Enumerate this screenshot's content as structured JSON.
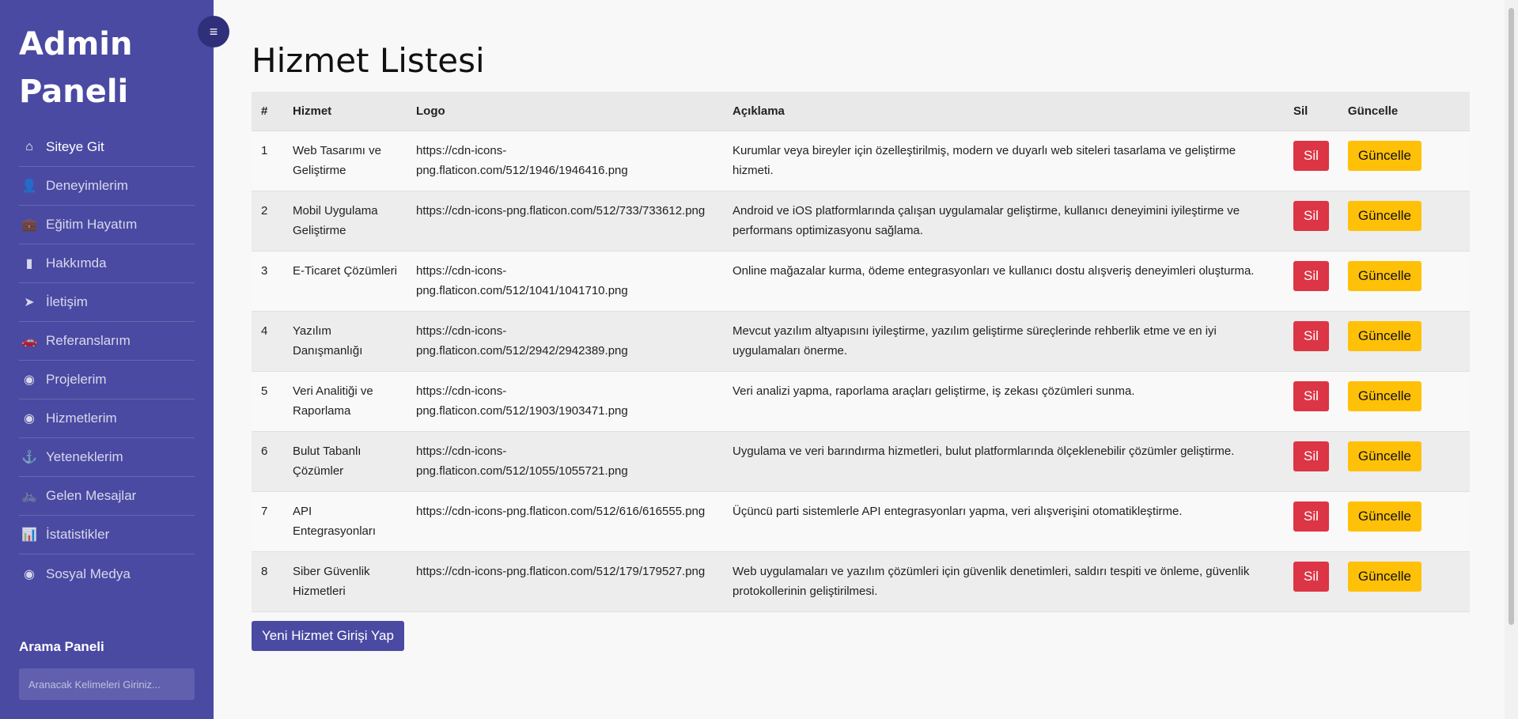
{
  "sidebar": {
    "brand": "Admin Paneli",
    "menu": [
      {
        "label": "Siteye Git",
        "icon": "home-icon",
        "glyph": "⌂",
        "active": true
      },
      {
        "label": "Deneyimlerim",
        "icon": "user-icon",
        "glyph": "👤",
        "active": false
      },
      {
        "label": "Eğitim Hayatım",
        "icon": "briefcase-icon",
        "glyph": "💼",
        "active": false
      },
      {
        "label": "Hakkımda",
        "icon": "sticky-note-icon",
        "glyph": "▮",
        "active": false
      },
      {
        "label": "İletişim",
        "icon": "paper-plane-icon",
        "glyph": "➤",
        "active": false
      },
      {
        "label": "Referanslarım",
        "icon": "car-icon",
        "glyph": "🚗",
        "active": false
      },
      {
        "label": "Projelerim",
        "icon": "user-circle-icon",
        "glyph": "◉",
        "active": false
      },
      {
        "label": "Hizmetlerim",
        "icon": "user-circle-icon",
        "glyph": "◉",
        "active": false
      },
      {
        "label": "Yeteneklerim",
        "icon": "anchor-icon",
        "glyph": "⚓",
        "active": false
      },
      {
        "label": "Gelen Mesajlar",
        "icon": "bicycle-icon",
        "glyph": "🚲",
        "active": false
      },
      {
        "label": "İstatistikler",
        "icon": "bar-chart-icon",
        "glyph": "📊",
        "active": false
      },
      {
        "label": "Sosyal Medya",
        "icon": "user-circle-icon",
        "glyph": "◉",
        "active": false
      }
    ],
    "search_title": "Arama Paneli",
    "search_placeholder": "Aranacak Kelimeleri Giriniz..."
  },
  "toggle": {
    "icon": "hamburger-menu-icon",
    "glyph": "≡"
  },
  "page_title": "Hizmet Listesi",
  "table": {
    "headers": [
      "#",
      "Hizmet",
      "Logo",
      "Açıklama",
      "Sil",
      "Güncelle"
    ],
    "rows": [
      {
        "num": "1",
        "service": "Web Tasarımı ve Geliştirme",
        "logo": "https://cdn-icons-png.flaticon.com/512/1946/1946416.png",
        "desc": "Kurumlar veya bireyler için özelleştirilmiş, modern ve duyarlı web siteleri tasarlama ve geliştirme hizmeti."
      },
      {
        "num": "2",
        "service": "Mobil Uygulama Geliştirme",
        "logo": "https://cdn-icons-png.flaticon.com/512/733/733612.png",
        "desc": "Android ve iOS platformlarında çalışan uygulamalar geliştirme, kullanıcı deneyimini iyileştirme ve performans optimizasyonu sağlama."
      },
      {
        "num": "3",
        "service": "E-Ticaret Çözümleri",
        "logo": "https://cdn-icons-png.flaticon.com/512/1041/1041710.png",
        "desc": "Online mağazalar kurma, ödeme entegrasyonları ve kullanıcı dostu alışveriş deneyimleri oluşturma."
      },
      {
        "num": "4",
        "service": "Yazılım Danışmanlığı",
        "logo": "https://cdn-icons-png.flaticon.com/512/2942/2942389.png",
        "desc": "Mevcut yazılım altyapısını iyileştirme, yazılım geliştirme süreçlerinde rehberlik etme ve en iyi uygulamaları önerme."
      },
      {
        "num": "5",
        "service": "Veri Analitiği ve Raporlama",
        "logo": "https://cdn-icons-png.flaticon.com/512/1903/1903471.png",
        "desc": "Veri analizi yapma, raporlama araçları geliştirme, iş zekası çözümleri sunma."
      },
      {
        "num": "6",
        "service": "Bulut Tabanlı Çözümler",
        "logo": "https://cdn-icons-png.flaticon.com/512/1055/1055721.png",
        "desc": "Uygulama ve veri barındırma hizmetleri, bulut platformlarında ölçeklenebilir çözümler geliştirme."
      },
      {
        "num": "7",
        "service": "API Entegrasyonları",
        "logo": "https://cdn-icons-png.flaticon.com/512/616/616555.png",
        "desc": "Üçüncü parti sistemlerle API entegrasyonları yapma, veri alışverişini otomatikleştirme."
      },
      {
        "num": "8",
        "service": "Siber Güvenlik Hizmetleri",
        "logo": "https://cdn-icons-png.flaticon.com/512/179/179527.png",
        "desc": "Web uygulamaları ve yazılım çözümleri için güvenlik denetimleri, saldırı tespiti ve önleme, güvenlik protokollerinin geliştirilmesi."
      }
    ],
    "delete_label": "Sil",
    "update_label": "Güncelle"
  },
  "new_button_label": "Yeni Hizmet Girişi Yap",
  "colors": {
    "sidebar_bg": "#4a4aa3",
    "delete_btn": "#dc3545",
    "update_btn": "#ffc107",
    "primary_btn": "#4a4aa3"
  }
}
